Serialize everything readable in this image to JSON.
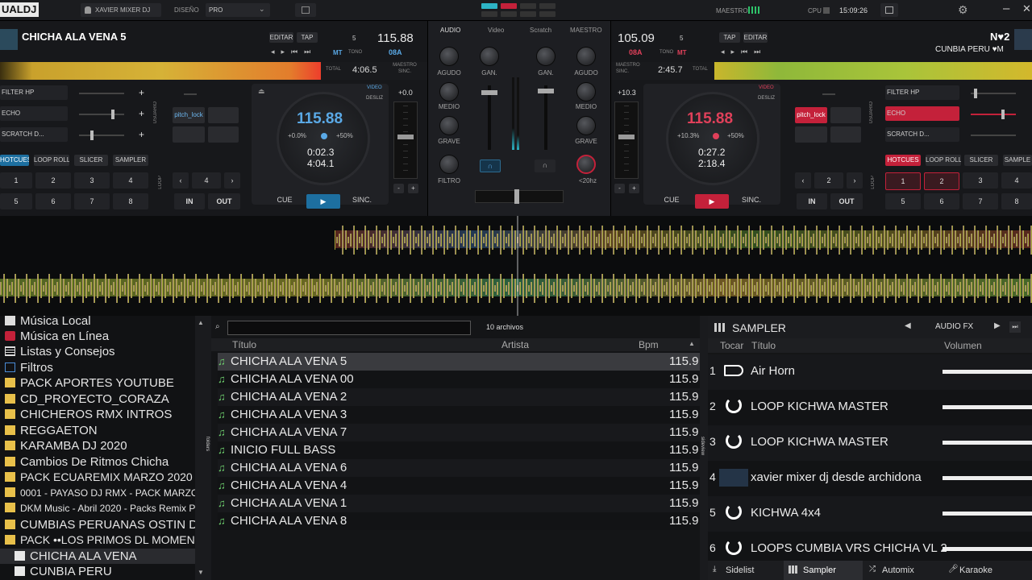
{
  "topbar": {
    "logo": "UALDJ",
    "user": "XAVIER MIXER DJ",
    "layout_label": "DISEÑO",
    "layout_value": "PRO",
    "master_label": "MAESTRO",
    "cpu_label": "CPU",
    "time": "15:09:26"
  },
  "deck_left": {
    "title": "CHICHA ALA VENA 5",
    "edit_label": "EDITAR",
    "tap_label": "TAP",
    "beats": "5",
    "bpm": "115.88",
    "mt": "MT",
    "tono": "TONO",
    "key": "08A",
    "total": "TOTAL",
    "remain": "4:06.5",
    "maestro_sinc": "MAESTRO SINC.",
    "filter": "FILTER HP",
    "echo": "ECHO",
    "scratch": "SCRATCH D...",
    "user_side": "USUARIO",
    "pitch_lock": "pitch_lock",
    "video": "VIDEO",
    "desliz": "DESLIZ",
    "pitch": "+0.0",
    "platter_bpm": "115.88",
    "pct_left": "+0.0%",
    "pct_right": "+50%",
    "elapsed": "0:02.3",
    "total_time": "4:04.1",
    "pads_tabs": [
      "HOTCUES",
      "LOOP ROLL",
      "SLICER",
      "SAMPLER"
    ],
    "pads": [
      "1",
      "2",
      "3",
      "4",
      "5",
      "6",
      "7",
      "8"
    ],
    "loop_label": "LOOP",
    "loop_size": "4",
    "in": "IN",
    "out": "OUT",
    "cue": "CUE",
    "sinc": "SINC.",
    "minus": "-",
    "plus": "+"
  },
  "deck_right": {
    "bpm": "105.09",
    "beats": "5",
    "key": "08A",
    "tono": "TONO",
    "mt": "MT",
    "elapsed": "2:45.7",
    "maestro_sinc": "MAESTRO SINC.",
    "total": "TOTAL",
    "tap_label": "TAP",
    "edit_label": "EDITAR",
    "deck_name": "N♥2",
    "title": "CUNBIA PERU ♥M",
    "filter": "FILTER HP",
    "echo": "ECHO",
    "scratch": "SCRATCH D...",
    "pitch_lock": "pitch_lock",
    "video": "VIDEO",
    "desliz": "DESLIZ",
    "pitch": "+10.3",
    "platter_bpm": "115.88",
    "pct_left": "+10.3%",
    "pct_right": "+50%",
    "elapsed2": "0:27.2",
    "total_time": "2:18.4",
    "pads_tabs": [
      "HOTCUES",
      "LOOP ROLL",
      "SLICER",
      "SAMPLE"
    ],
    "pads": [
      "1",
      "2",
      "3",
      "4",
      "5",
      "6",
      "7",
      "8"
    ],
    "loop_label": "LOOP",
    "loop_size": "2",
    "user_side": "USUARIO",
    "in": "IN",
    "out": "OUT",
    "cue": "CUE",
    "sinc": "SINC.",
    "minus": "-",
    "plus": "+"
  },
  "mixer": {
    "tabs": [
      "AUDIO",
      "Video",
      "Scratch",
      "MAESTRO"
    ],
    "agudo": "AGUDO",
    "medio": "MEDIO",
    "grave": "GRAVE",
    "gan": "GAN.",
    "filtro": "FILTRO",
    "hz": "<20hz"
  },
  "browser": {
    "tree": [
      {
        "label": "Música Local",
        "icon": "computer-icon"
      },
      {
        "label": "Música en Línea",
        "icon": "online-icon"
      },
      {
        "label": "Listas y Consejos",
        "icon": "list-icon"
      },
      {
        "label": "Filtros",
        "icon": "filter-icon"
      },
      {
        "label": "PACK APORTES YOUTUBE",
        "icon": "star-folder-icon"
      },
      {
        "label": "CD_PROYECTO_CORAZA",
        "icon": "star-folder-icon"
      },
      {
        "label": "CHICHEROS RMX INTROS",
        "icon": "star-folder-icon"
      },
      {
        "label": "REGGAETON",
        "icon": "star-folder-icon"
      },
      {
        "label": "KARAMBA DJ 2020",
        "icon": "star-folder-icon"
      },
      {
        "label": "Cambios De Ritmos Chicha",
        "icon": "star-folder-icon"
      },
      {
        "label": "PACK ECUAREMIX MARZO  2020",
        "icon": "star-folder-icon"
      },
      {
        "label": "0001 - PAYASO DJ RMX - PACK MARZO MULT",
        "icon": "star-folder-icon"
      },
      {
        "label": "DKM Music - Abril 2020 - Packs Remix Para Djs",
        "icon": "star-folder-icon"
      },
      {
        "label": "CUMBIAS PERUANAS OSTIN DJ",
        "icon": "star-folder-icon"
      },
      {
        "label": "PACK ••LOS PRIMOS DL MOMENTO••",
        "icon": "star-folder-icon"
      },
      {
        "label": "CHICHA ALA VENA",
        "icon": "folder-icon"
      },
      {
        "label": "CUNBIA PERU",
        "icon": "folder-icon"
      }
    ],
    "folders_tab": "folders",
    "sideview_tab": "sideview",
    "search_placeholder": "",
    "file_count": "10 archivos",
    "columns": {
      "title": "Título",
      "artist": "Artista",
      "bpm": "Bpm"
    },
    "tracks": [
      {
        "title": "CHICHA ALA VENA 5",
        "artist": "",
        "bpm": "115.9"
      },
      {
        "title": "CHICHA ALA VENA 00",
        "artist": "",
        "bpm": "115.9"
      },
      {
        "title": "CHICHA ALA VENA 2",
        "artist": "",
        "bpm": "115.9"
      },
      {
        "title": "CHICHA ALA VENA 3",
        "artist": "",
        "bpm": "115.9"
      },
      {
        "title": "CHICHA ALA VENA 7",
        "artist": "",
        "bpm": "115.9"
      },
      {
        "title": "INICIO FULL BASS",
        "artist": "",
        "bpm": "115.9"
      },
      {
        "title": "CHICHA ALA VENA 6",
        "artist": "",
        "bpm": "115.9"
      },
      {
        "title": "CHICHA ALA VENA 4",
        "artist": "",
        "bpm": "115.9"
      },
      {
        "title": "CHICHA ALA VENA 1",
        "artist": "",
        "bpm": "115.9"
      },
      {
        "title": "CHICHA ALA VENA 8",
        "artist": "",
        "bpm": "115.9"
      }
    ]
  },
  "sampler": {
    "title": "SAMPLER",
    "bank": "AUDIO FX",
    "col_play": "Tocar",
    "col_title": "Título",
    "col_volume": "Volumen",
    "items": [
      {
        "n": "1",
        "name": "Air Horn",
        "icon": "horn-icon"
      },
      {
        "n": "2",
        "name": "LOOP KICHWA MASTER",
        "icon": "loop-icon"
      },
      {
        "n": "3",
        "name": "LOOP KICHWA MASTER",
        "icon": "loop-icon"
      },
      {
        "n": "4",
        "name": "xavier mixer dj desde archidona",
        "icon": "video-thumb-icon"
      },
      {
        "n": "5",
        "name": "KICHWA 4x4",
        "icon": "loop-icon"
      },
      {
        "n": "6",
        "name": "LOOPS CUMBIA VRS CHICHA VL 2",
        "icon": "loop-icon"
      }
    ]
  },
  "bottom_tabs": [
    "Sidelist",
    "Sampler",
    "Automix",
    "Karaoke"
  ],
  "colors": {
    "accent_blue": "#1d6fa0",
    "accent_red": "#c4213a",
    "bpm_blue": "#5aa9e6",
    "bpm_red": "#e0405a"
  }
}
